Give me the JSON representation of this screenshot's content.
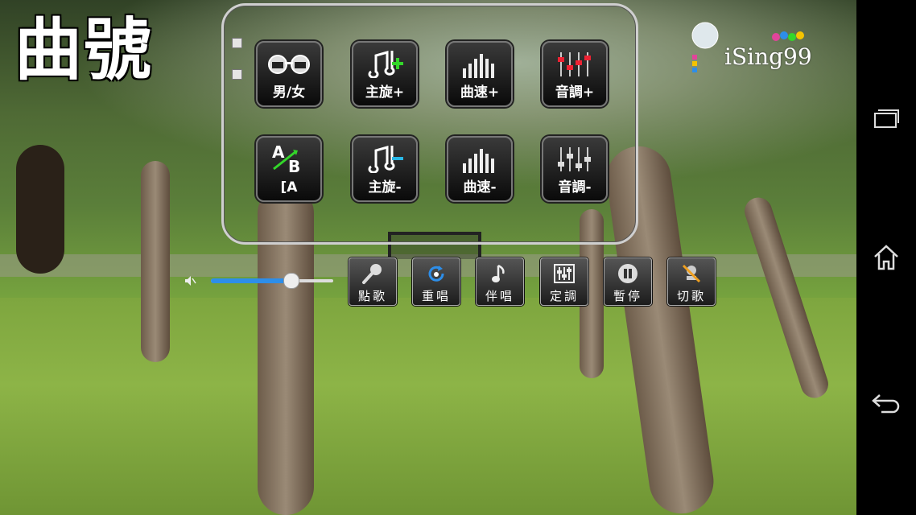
{
  "title": "曲號",
  "logo": {
    "brand": "iSing99"
  },
  "control_panel": {
    "row1": [
      {
        "label": "男/女",
        "icon": "glasses-icon"
      },
      {
        "label": "主旋+",
        "icon": "melody-plus-icon"
      },
      {
        "label": "曲速+",
        "icon": "tempo-bars-icon"
      },
      {
        "label": "音調+",
        "icon": "pitch-sliders-icon"
      }
    ],
    "row2": [
      {
        "label": "[A",
        "icon": "ab-switch-icon",
        "sub": "AB"
      },
      {
        "label": "主旋-",
        "icon": "melody-minus-icon"
      },
      {
        "label": "曲速-",
        "icon": "tempo-bars-icon"
      },
      {
        "label": "音調-",
        "icon": "pitch-sliders-icon"
      }
    ]
  },
  "toolbar": {
    "volume_level": 0.65,
    "buttons": [
      {
        "label": "點歌",
        "icon": "microphone-icon"
      },
      {
        "label": "重唱",
        "icon": "replay-icon"
      },
      {
        "label": "伴唱",
        "icon": "music-note-icon"
      },
      {
        "label": "定調",
        "icon": "equalizer-icon"
      },
      {
        "label": "暫停",
        "icon": "pause-icon"
      },
      {
        "label": "切歌",
        "icon": "skip-song-icon"
      }
    ]
  },
  "navbar": {
    "icons": [
      "recent-apps-icon",
      "home-icon",
      "back-icon"
    ]
  },
  "colors": {
    "accent": "#2d8ee9",
    "plus": "#33d62a",
    "minus": "#29b7e6"
  }
}
